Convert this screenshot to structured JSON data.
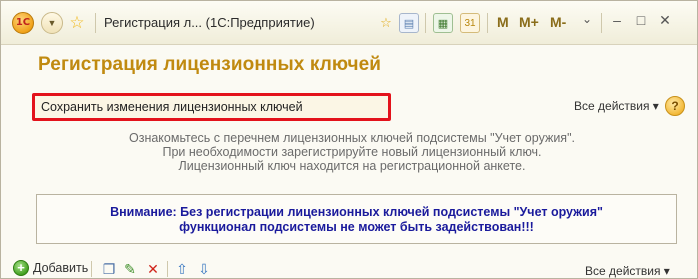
{
  "window": {
    "title": "Регистрация л... (1С:Предприятие)",
    "logo_text": "1С"
  },
  "titlebar_buttons": {
    "m": "M",
    "m_plus": "M+",
    "m_minus": "M-",
    "dropdown": "⌄",
    "minimize": "–",
    "maximize": "□",
    "close": "✕"
  },
  "form": {
    "title": "Регистрация лицензионных ключей"
  },
  "command_bar": {
    "save_label": "Сохранить изменения лицензионных ключей",
    "all_actions_label": "Все действия ▾",
    "help_label": "?"
  },
  "info": {
    "line1": "Ознакомьтесь с перечнем лицензионных ключей подсистемы \"Учет оружия\".",
    "line2": "При необходимости зарегистрируйте новый лицензионный ключ.",
    "line3": "Лицензионный ключ находится на регистрационной анкете."
  },
  "warning": {
    "line1": "Внимание: Без регистрации лицензионных ключей подсистемы \"Учет оружия\"",
    "line2": "функционал подсистемы не может быть задействован!!!"
  },
  "bottom_toolbar": {
    "add_label": "Добавить",
    "all_actions_label": "Все действия ▾"
  },
  "colors": {
    "title_accent": "#c08a10",
    "highlight_border": "#e3121b",
    "warning_text": "#1a1a9c"
  },
  "icons": [
    "1c-logo-icon",
    "menu-circle-icon",
    "favorite-star-icon",
    "add-favorite-icon",
    "history-icon",
    "calculator-icon",
    "calendar-icon",
    "help-icon",
    "add-icon",
    "copy-icon",
    "edit-icon",
    "delete-icon",
    "move-up-icon",
    "move-down-icon"
  ]
}
